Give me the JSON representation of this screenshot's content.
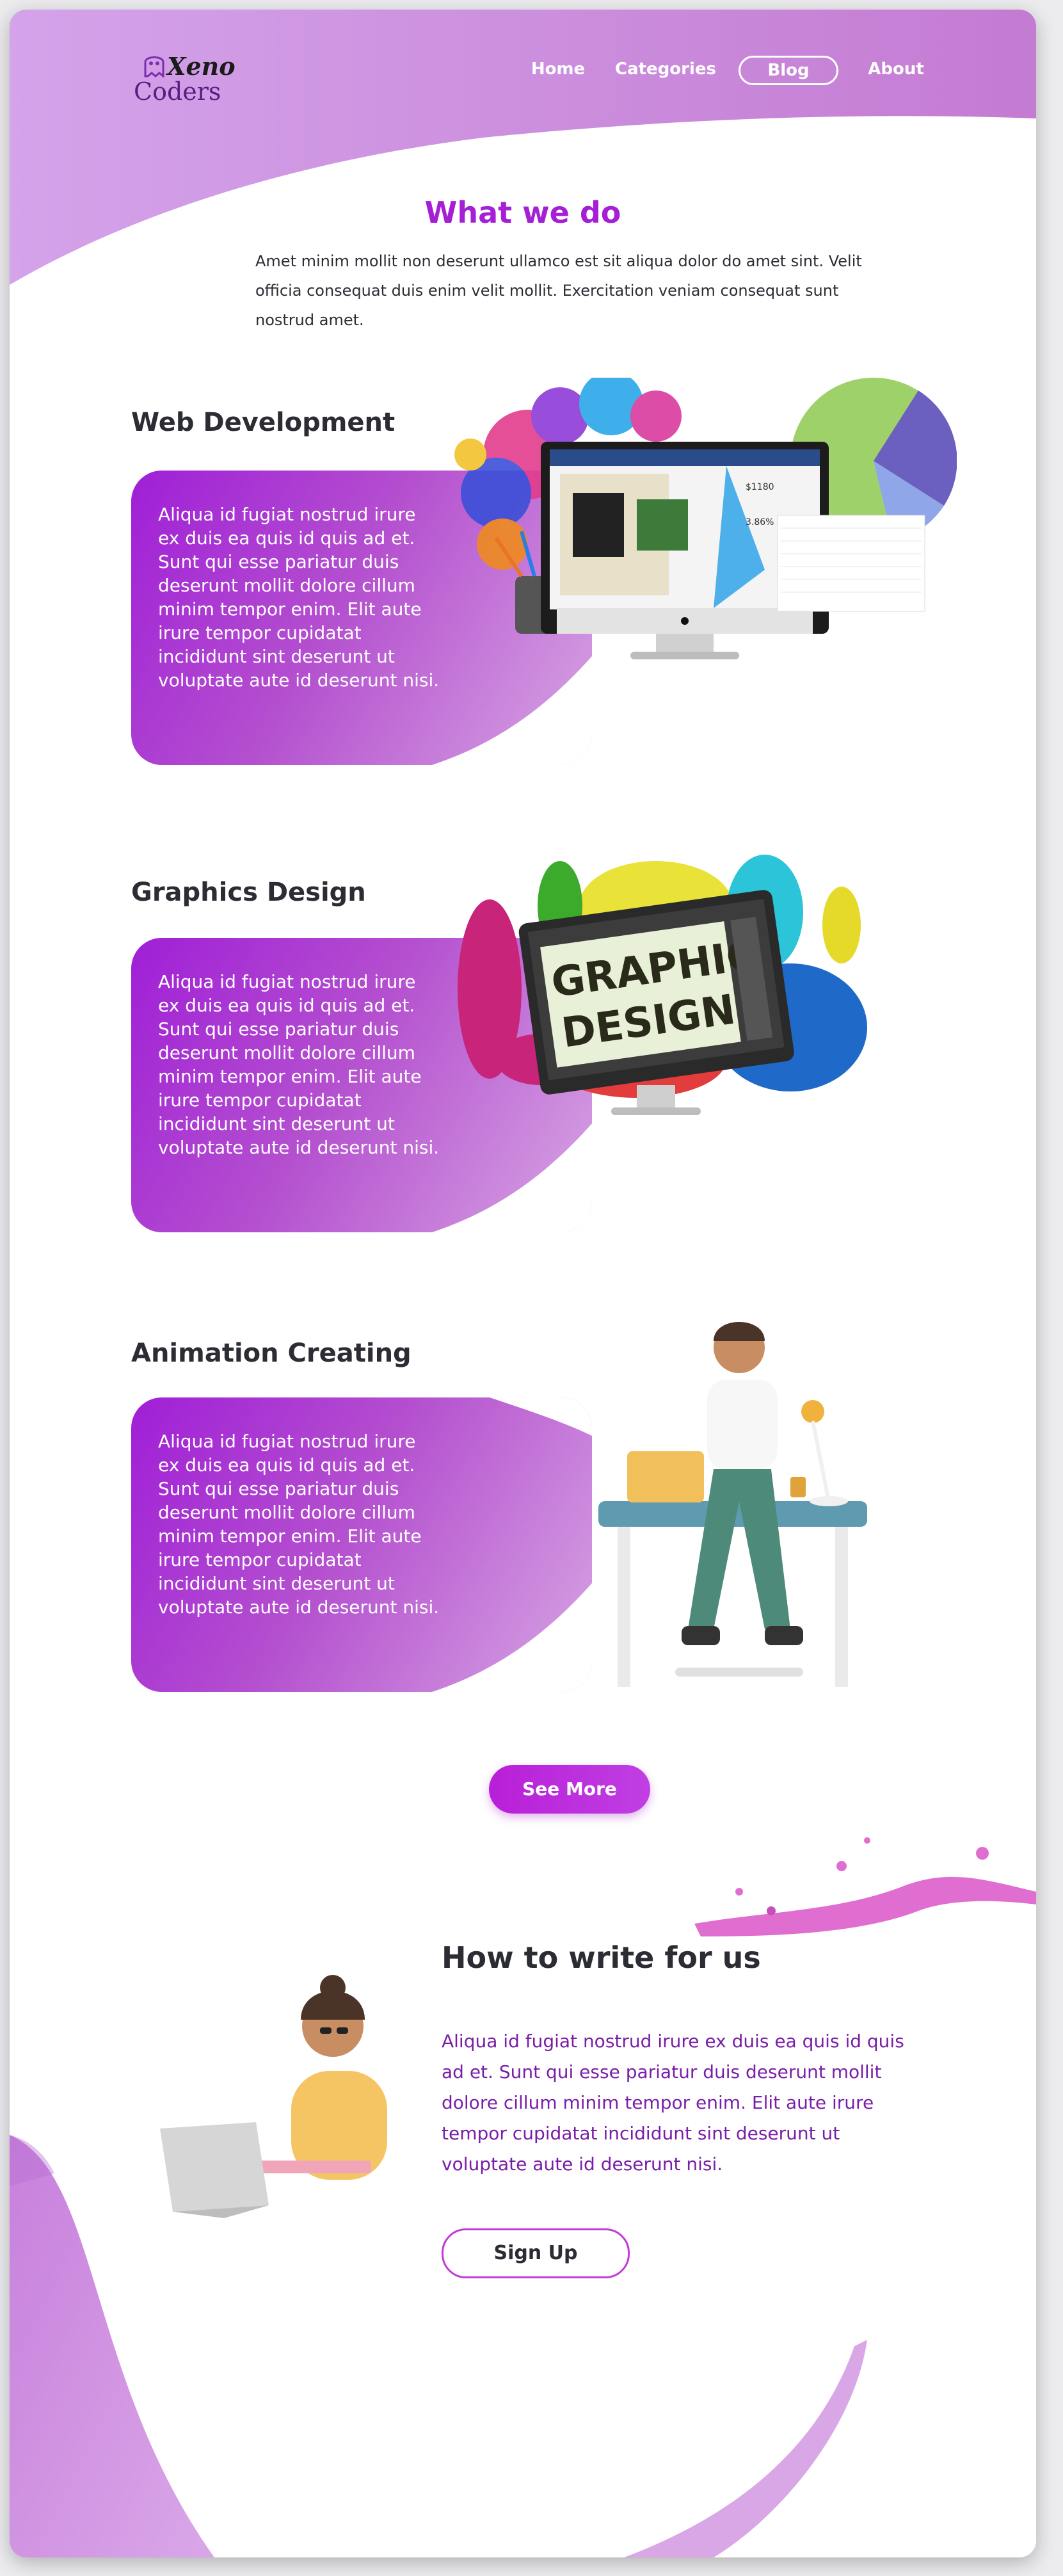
{
  "brand": {
    "name_top": "Xeno",
    "name_bottom": "Coders",
    "icon": "ghost-icon"
  },
  "nav": {
    "items": [
      "Home",
      "Categories",
      "Blog",
      "About"
    ],
    "active": "Blog"
  },
  "what_we_do": {
    "title": "What we do",
    "intro": "Amet minim mollit non deserunt ullamco est sit aliqua dolor do amet sint. Velit officia consequat duis enim velit mollit. Exercitation veniam consequat sunt nostrud amet."
  },
  "services": [
    {
      "title": "Web Development",
      "text": "Aliqua id fugiat nostrud irure ex duis ea quis id quis ad et. Sunt qui esse pariatur duis deserunt mollit dolore cillum minim tempor enim. Elit aute irure tempor cupidatat incididunt sint deserunt ut voluptate aute id deserunt nisi.",
      "illustration": "web-development-monitor-illustration",
      "mock_price": "$1180",
      "mock_percent": "3.86%"
    },
    {
      "title": "Graphics Design",
      "text": "Aliqua id fugiat nostrud irure ex duis ea quis id quis ad et. Sunt qui esse pariatur duis deserunt mollit dolore cillum minim tempor enim. Elit aute irure tempor cupidatat incididunt sint deserunt ut voluptate aute id deserunt nisi.",
      "illustration": "graphic-design-monitor-illustration",
      "screen_line1": "GRAPHIC",
      "screen_line2": "DESIGN"
    },
    {
      "title": "Animation Creating",
      "text": "Aliqua id fugiat nostrud irure ex duis ea quis id quis ad et. Sunt qui esse pariatur duis deserunt mollit dolore cillum minim tempor enim. Elit aute irure tempor cupidatat incididunt sint deserunt ut voluptate aute id deserunt nisi.",
      "illustration": "man-at-desk-illustration"
    }
  ],
  "see_more": "See More",
  "write": {
    "title": "How to write for us",
    "text": "Aliqua id fugiat nostrud irure ex duis ea quis id quis ad et. Sunt qui esse pariatur duis deserunt mollit dolore cillum minim tempor enim. Elit aute irure tempor cupidatat incididunt sint deserunt ut voluptate aute id deserunt nisi.",
    "button": "Sign Up",
    "illustration": "woman-with-laptop-illustration"
  },
  "colors": {
    "accent": "#a51fd6",
    "header_bg": "#c98ad8",
    "card_start": "#a01fd7",
    "card_end": "#d7a5e3",
    "text_dark": "#2c2c34"
  }
}
